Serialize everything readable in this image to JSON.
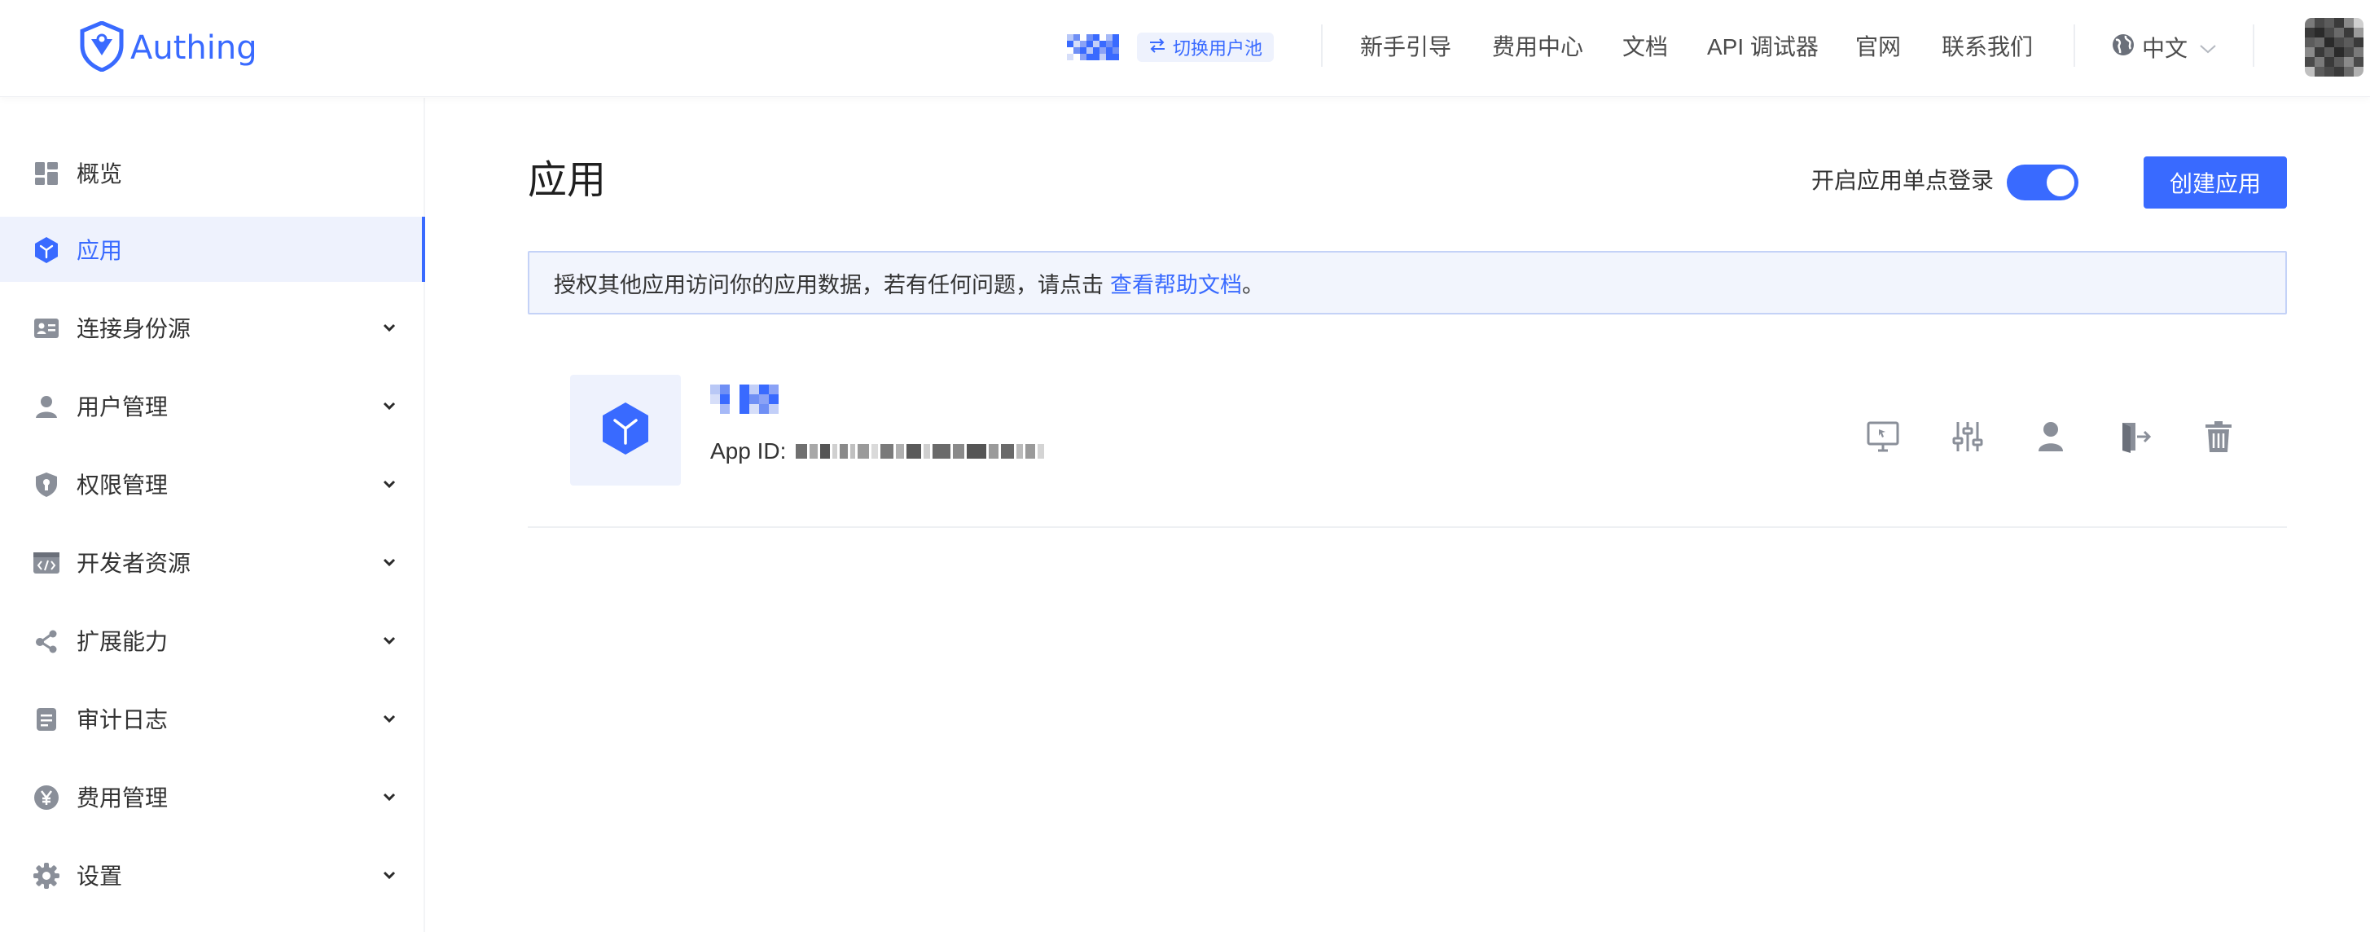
{
  "header": {
    "brand": "Authing",
    "switch_pool": "切换用户池",
    "nav": [
      "新手引导",
      "费用中心",
      "文档",
      "API 调试器",
      "官网",
      "联系我们"
    ],
    "language": "中文",
    "icons": {
      "logo": "shield-logo-icon",
      "switch": "swap-icon",
      "language": "globe-icon",
      "dropdown": "chevron-down-icon"
    }
  },
  "sidebar": {
    "items": [
      {
        "label": "概览",
        "icon": "dashboard-icon",
        "expandable": false
      },
      {
        "label": "应用",
        "icon": "cube-icon",
        "expandable": false,
        "active": true
      },
      {
        "label": "连接身份源",
        "icon": "id-card-icon",
        "expandable": true
      },
      {
        "label": "用户管理",
        "icon": "user-icon",
        "expandable": true
      },
      {
        "label": "权限管理",
        "icon": "shield-icon",
        "expandable": true
      },
      {
        "label": "开发者资源",
        "icon": "code-icon",
        "expandable": true
      },
      {
        "label": "扩展能力",
        "icon": "share-nodes-icon",
        "expandable": true
      },
      {
        "label": "审计日志",
        "icon": "document-icon",
        "expandable": true
      },
      {
        "label": "费用管理",
        "icon": "yen-icon",
        "expandable": true
      },
      {
        "label": "设置",
        "icon": "gear-icon",
        "expandable": true
      }
    ]
  },
  "main": {
    "title": "应用",
    "sso_label": "开启应用单点登录",
    "sso_enabled": true,
    "create_button": "创建应用",
    "notice": {
      "text": "授权其他应用访问你的应用数据，若有任何问题，请点击",
      "link": "查看帮助文档",
      "suffix": "。"
    },
    "apps": [
      {
        "id_label": "App ID:",
        "icon": "cube-icon",
        "actions": [
          "monitor-icon",
          "sliders-icon",
          "user-icon",
          "logout-icon",
          "trash-icon"
        ]
      }
    ]
  },
  "colors": {
    "accent": "#396aff",
    "accent_bg": "#eef2fd",
    "notice_border": "#c4d2f7",
    "text": "#333333",
    "icon_gray": "#8a8f99"
  }
}
